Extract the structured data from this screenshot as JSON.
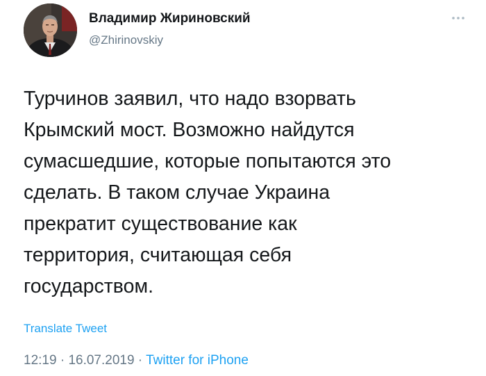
{
  "tweet": {
    "display_name": "Владимир Жириновский",
    "handle": "@Zhirinovskiy",
    "text": "Турчинов заявил, что надо взорвать\nКрымский мост. Возможно найдутся\nсумасшедшие, которые попытаются это\nсделать. В таком случае Украина\nпрекратит существование как\nтерритория, считающая себя\nгосударством.",
    "translate_label": "Translate Tweet",
    "time": "12:19",
    "separator": " · ",
    "date": "16.07.2019",
    "source": "Twitter for iPhone"
  },
  "icons": {
    "more": "more-dots-icon",
    "avatar": "profile-photo"
  },
  "colors": {
    "text": "#14171a",
    "secondary": "#657786",
    "link": "#1da1f2",
    "background": "#ffffff"
  }
}
